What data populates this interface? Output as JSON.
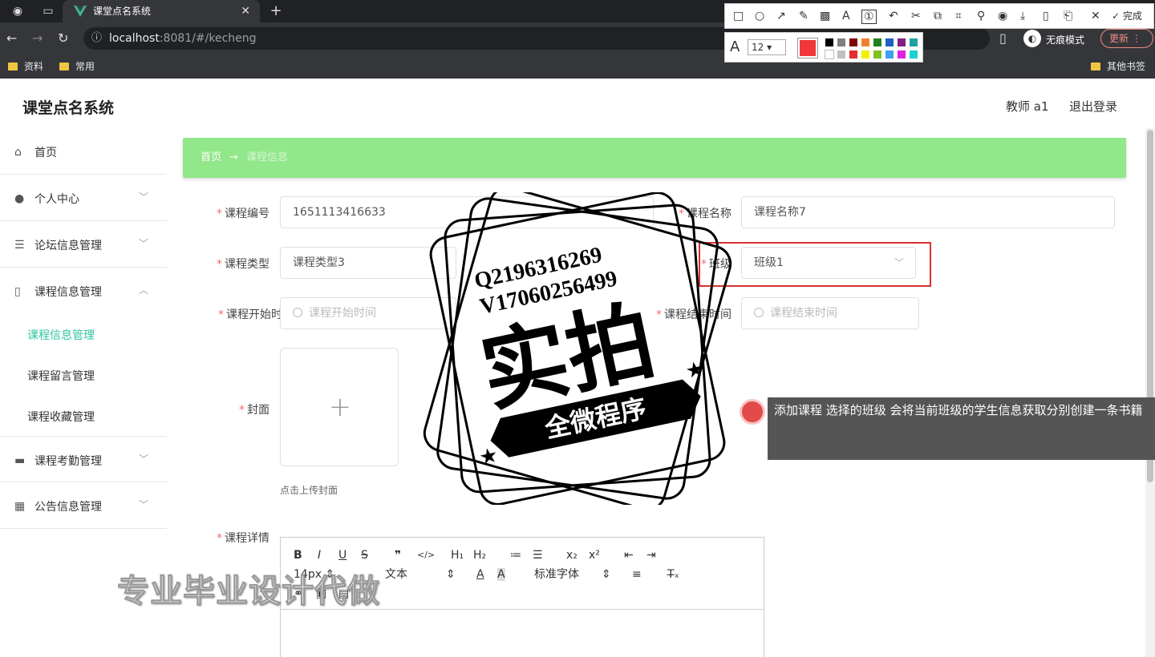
{
  "browser": {
    "tab_title": "课堂点名系统",
    "url_host": "localhost",
    "url_rest": ":8081/#/kecheng",
    "incognito_label": "无痕模式",
    "update_label": "更新",
    "bookmarks": [
      "资料",
      "常用"
    ],
    "other_bookmarks": "其他书签"
  },
  "snip_toolbar": {
    "done_label": "完成",
    "font_size": "12",
    "colors": [
      "#000000",
      "#808080",
      "#800000",
      "#f08030",
      "#208020",
      "#2060c0",
      "#802080",
      "#20a0a0",
      "#ffffff",
      "#c0c0c0",
      "#e03030",
      "#f0f000",
      "#80c020",
      "#40a0f0",
      "#e020e0",
      "#20d0d0"
    ],
    "selected_color": "#f03838"
  },
  "app": {
    "title": "课堂点名系统",
    "user": "教师 a1",
    "logout": "退出登录"
  },
  "sidebar": {
    "home": "首页",
    "personal": "个人中心",
    "forum": "论坛信息管理",
    "course": "课程信息管理",
    "course_sub": [
      "课程信息管理",
      "课程留言管理",
      "课程收藏管理"
    ],
    "attendance": "课程考勤管理",
    "notice": "公告信息管理"
  },
  "breadcrumb": {
    "home": "首页",
    "arrow": "→",
    "current": "课程信息"
  },
  "form": {
    "course_no_label": "课程编号",
    "course_no_value": "1651113416633",
    "course_name_label": "课程名称",
    "course_name_value": "课程名称7",
    "course_type_label": "课程类型",
    "course_type_value": "课程类型3",
    "class_label": "班级",
    "class_value": "班级1",
    "start_label": "课程开始时间",
    "start_placeholder": "课程开始时间",
    "end_label": "课程结束时间",
    "end_placeholder": "课程结束时间",
    "cover_label": "封面",
    "cover_hint": "点击上传封面",
    "detail_label": "课程详情",
    "editor_size": "14px",
    "editor_text": "文本",
    "editor_font": "标准字体"
  },
  "overlay": {
    "stamp_line1": "Q2196316269",
    "stamp_line2": "V17060256499",
    "stamp_big": "实拍",
    "stamp_ribbon": "全微程序",
    "tooltip": "添加课程 选择的班级  会将当前班级的学生信息获取分别创建一条书籍",
    "watermark": "专业毕业设计代做"
  }
}
